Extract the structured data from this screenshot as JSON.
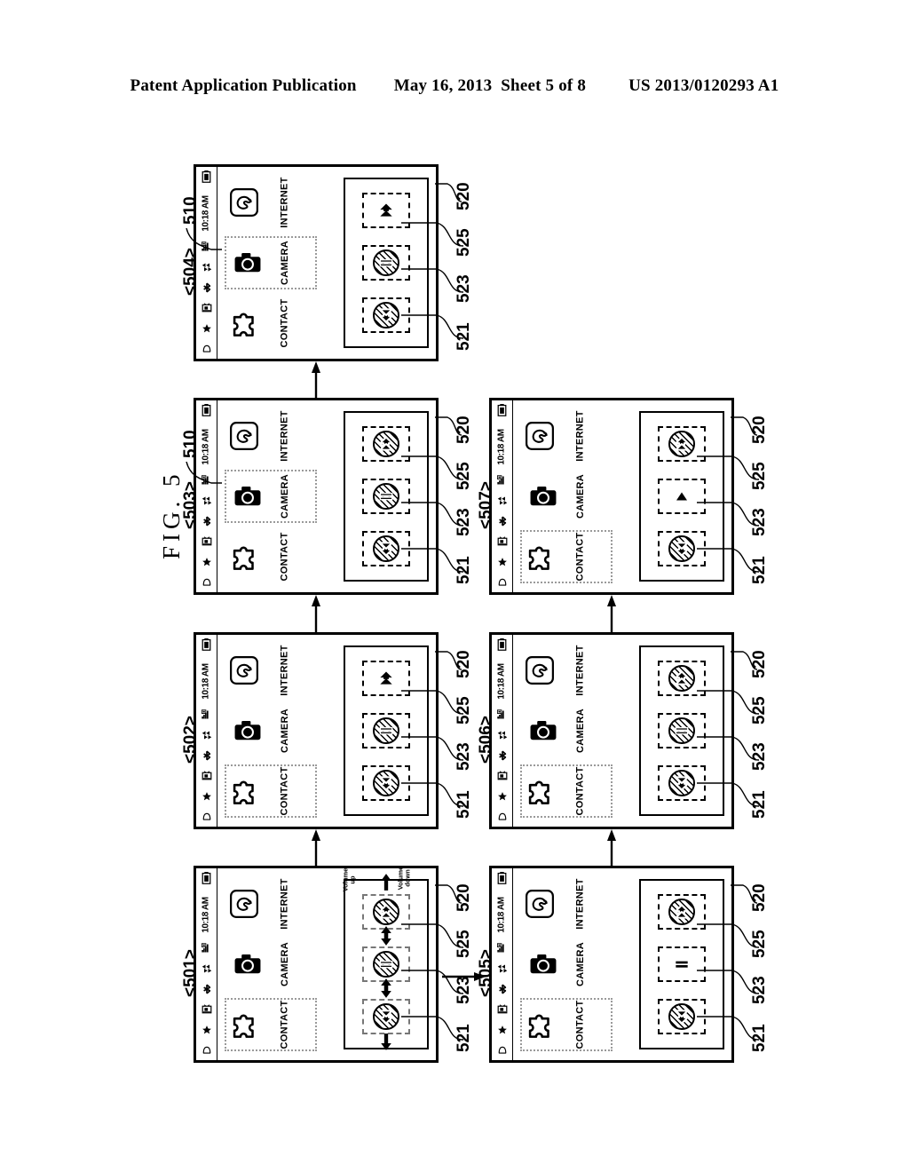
{
  "header": {
    "publication": "Patent Application Publication",
    "date": "May 16, 2013",
    "sheet": "Sheet 5 of 8",
    "number": "US 2013/0120293 A1"
  },
  "figure": {
    "caption": "FIG. 5",
    "device_ref": "510",
    "control_group_ref": "520"
  },
  "status_bar": {
    "time": "10:18 AM",
    "icons": [
      "battery-icon",
      "bell-icon",
      "star-icon",
      "tv-icon",
      "bluetooth-icon",
      "sync-icon",
      "signal-bars-icon"
    ]
  },
  "apps": [
    {
      "id": "contact",
      "label": "CONTACT",
      "icon": "puzzle-piece-icon"
    },
    {
      "id": "camera",
      "label": "CAMERA",
      "icon": "camera-icon"
    },
    {
      "id": "internet",
      "label": "INTERNET",
      "icon": "globe-icon"
    }
  ],
  "controls": [
    {
      "ref": "521",
      "name": "volume-down-control",
      "glyph": "double-arrow-down"
    },
    {
      "ref": "523",
      "name": "volume-pause-control",
      "glyph": "equals-bars"
    },
    {
      "ref": "525",
      "name": "volume-up-control",
      "glyph": "double-arrow-up"
    }
  ],
  "control_refs": [
    "521",
    "523",
    "525"
  ],
  "box_ref": "520",
  "volume_labels": {
    "up": "Volume\nup",
    "down": "Volume\ndown"
  },
  "panels": [
    {
      "id": "501",
      "label": "<501>",
      "selected_app": "contact",
      "show_device_ref": false,
      "show_volume_labels": true,
      "show_flank_arrows": true,
      "controls": [
        {
          "ref": "521",
          "glyph": "double-arrow-down",
          "hatched": true,
          "dashed": true,
          "dash_color": "gray"
        },
        {
          "ref": "523",
          "glyph": "equals-bars",
          "hatched": true,
          "dashed": true,
          "dash_color": "gray"
        },
        {
          "ref": "525",
          "glyph": "double-arrow-up",
          "hatched": true,
          "dashed": true,
          "dash_color": "gray"
        }
      ]
    },
    {
      "id": "502",
      "label": "<502>",
      "selected_app": "contact",
      "show_device_ref": false,
      "show_volume_labels": false,
      "show_flank_arrows": false,
      "controls": [
        {
          "ref": "521",
          "glyph": "double-arrow-down",
          "hatched": true,
          "dashed": true,
          "dash_color": "black"
        },
        {
          "ref": "523",
          "glyph": "equals-bars",
          "hatched": true,
          "dashed": true,
          "dash_color": "black"
        },
        {
          "ref": "525",
          "glyph": "double-arrow-up",
          "hatched": false,
          "dashed": true,
          "dash_color": "black"
        }
      ]
    },
    {
      "id": "503",
      "label": "<503>",
      "selected_app": "camera",
      "show_device_ref": true,
      "show_volume_labels": false,
      "show_flank_arrows": false,
      "controls": [
        {
          "ref": "521",
          "glyph": "double-arrow-down",
          "hatched": true,
          "dashed": true,
          "dash_color": "black"
        },
        {
          "ref": "523",
          "glyph": "equals-bars",
          "hatched": true,
          "dashed": true,
          "dash_color": "black"
        },
        {
          "ref": "525",
          "glyph": "double-arrow-up",
          "hatched": true,
          "dashed": true,
          "dash_color": "black"
        }
      ]
    },
    {
      "id": "504",
      "label": "<504>",
      "selected_app": "camera",
      "show_device_ref": true,
      "show_volume_labels": false,
      "show_flank_arrows": false,
      "controls": [
        {
          "ref": "521",
          "glyph": "double-arrow-down",
          "hatched": true,
          "dashed": true,
          "dash_color": "black"
        },
        {
          "ref": "523",
          "glyph": "equals-bars",
          "hatched": true,
          "dashed": true,
          "dash_color": "black"
        },
        {
          "ref": "525",
          "glyph": "double-arrow-up",
          "hatched": false,
          "dashed": true,
          "dash_color": "black"
        }
      ]
    },
    {
      "id": "505",
      "label": "<505>",
      "selected_app": "contact",
      "show_device_ref": false,
      "show_volume_labels": false,
      "show_flank_arrows": false,
      "controls": [
        {
          "ref": "521",
          "glyph": "double-arrow-down",
          "hatched": true,
          "dashed": true,
          "dash_color": "black"
        },
        {
          "ref": "523",
          "glyph": "equals-bars",
          "hatched": false,
          "dashed": true,
          "dash_color": "black"
        },
        {
          "ref": "525",
          "glyph": "double-arrow-up",
          "hatched": true,
          "dashed": true,
          "dash_color": "black"
        }
      ]
    },
    {
      "id": "506",
      "label": "<506>",
      "selected_app": "contact",
      "show_device_ref": false,
      "show_volume_labels": false,
      "show_flank_arrows": false,
      "controls": [
        {
          "ref": "521",
          "glyph": "double-arrow-down",
          "hatched": true,
          "dashed": true,
          "dash_color": "black"
        },
        {
          "ref": "523",
          "glyph": "equals-bars",
          "hatched": true,
          "dashed": true,
          "dash_color": "black"
        },
        {
          "ref": "525",
          "glyph": "double-arrow-up",
          "hatched": true,
          "dashed": true,
          "dash_color": "black"
        }
      ]
    },
    {
      "id": "507",
      "label": "<507>",
      "selected_app": "contact",
      "show_device_ref": false,
      "show_volume_labels": false,
      "show_flank_arrows": false,
      "controls": [
        {
          "ref": "521",
          "glyph": "double-arrow-down",
          "hatched": true,
          "dashed": true,
          "dash_color": "black"
        },
        {
          "ref": "523",
          "glyph": "triangle-up",
          "hatched": false,
          "dashed": true,
          "dash_color": "black"
        },
        {
          "ref": "525",
          "glyph": "double-arrow-up",
          "hatched": true,
          "dashed": true,
          "dash_color": "black"
        }
      ]
    }
  ],
  "flow": [
    {
      "from": "501",
      "to": "502",
      "direction": "up"
    },
    {
      "from": "502",
      "to": "503",
      "direction": "up"
    },
    {
      "from": "503",
      "to": "504",
      "direction": "up"
    },
    {
      "from": "501",
      "to": "505",
      "direction": "right"
    },
    {
      "from": "505",
      "to": "506",
      "direction": "up"
    },
    {
      "from": "506",
      "to": "507",
      "direction": "up"
    }
  ]
}
